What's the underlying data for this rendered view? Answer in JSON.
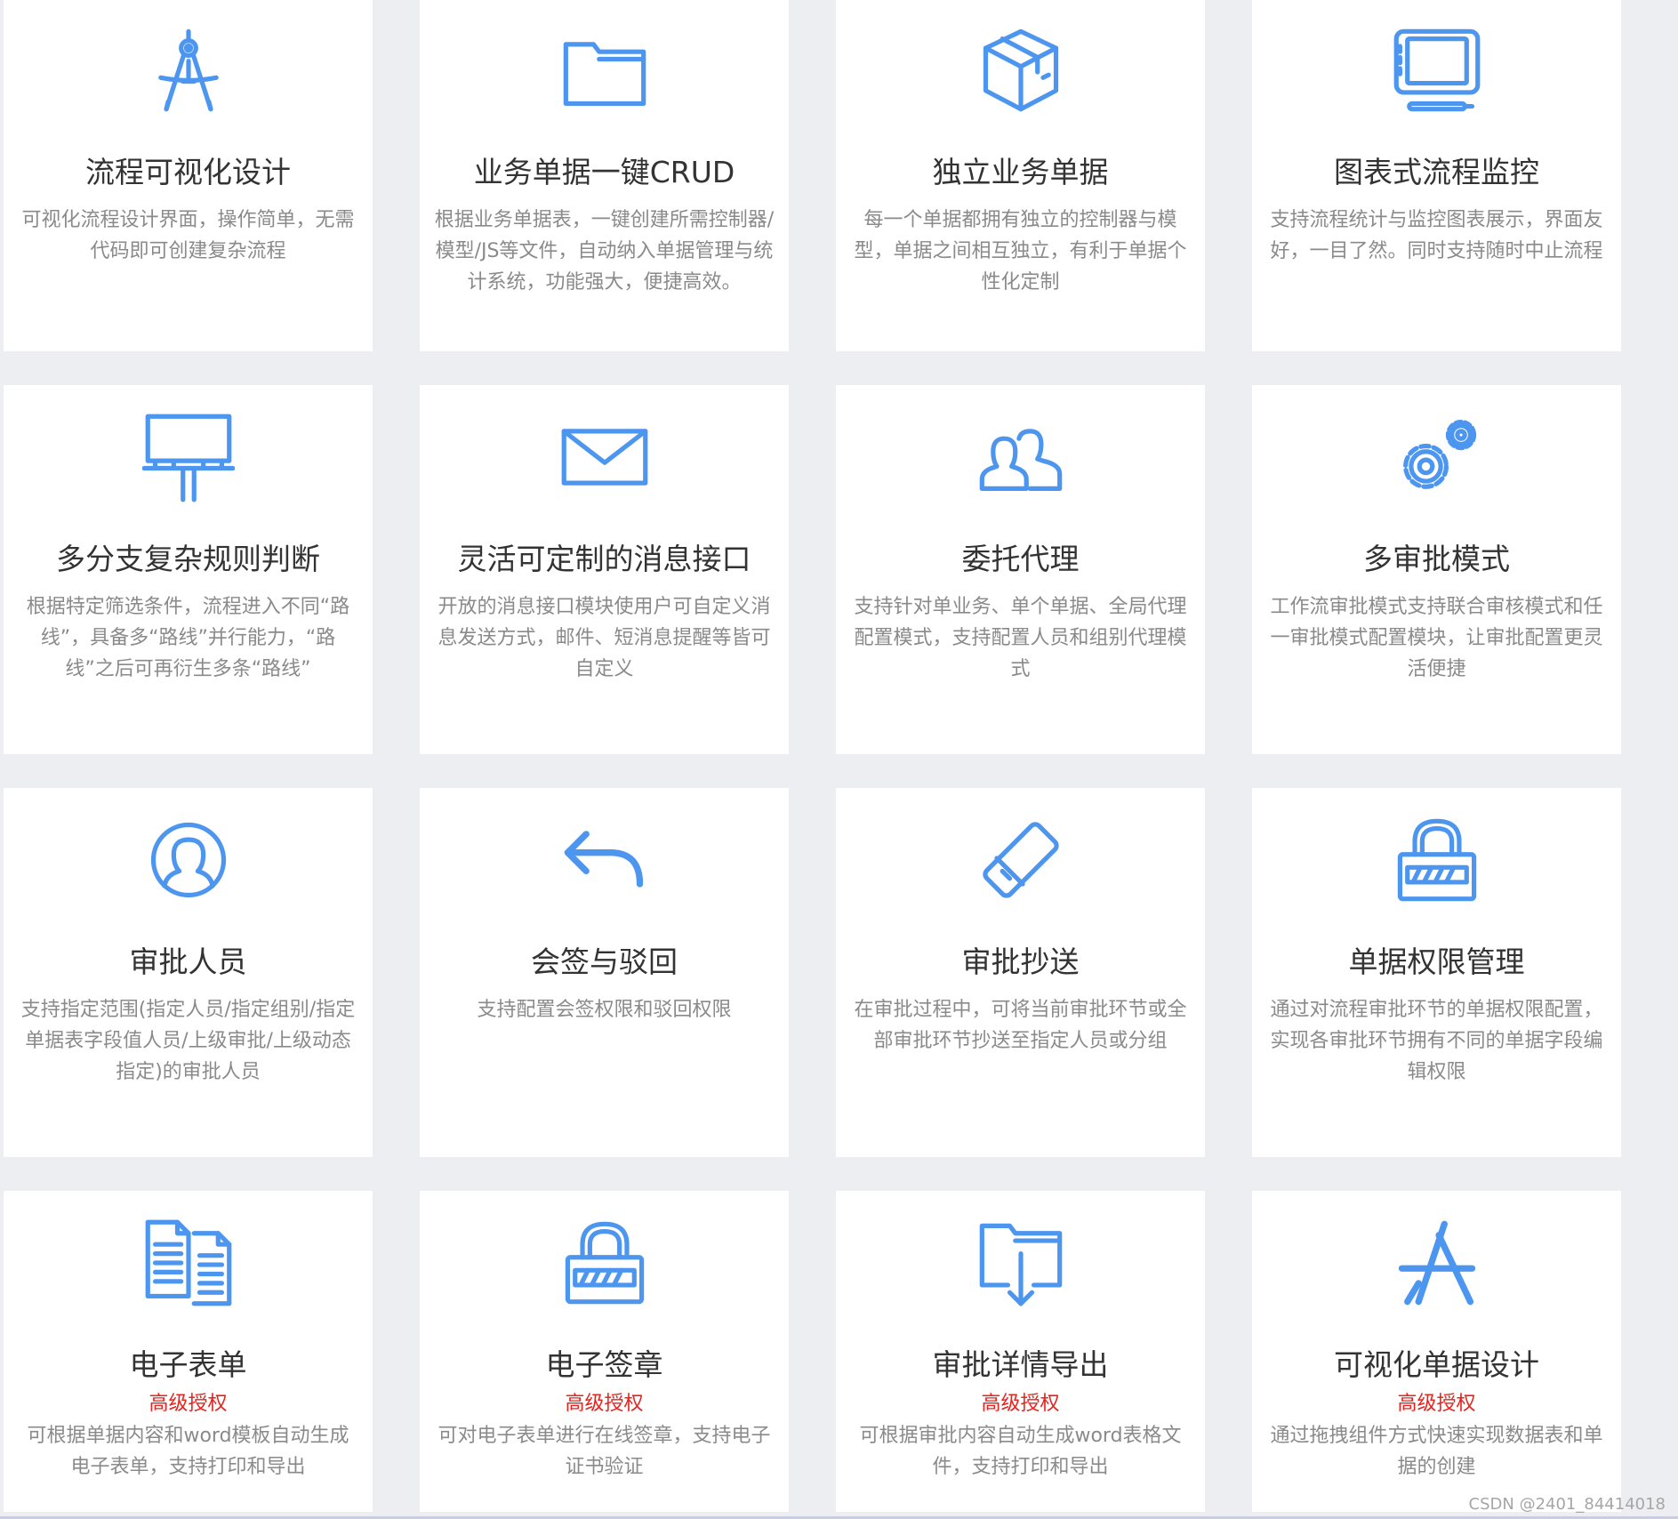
{
  "features": [
    {
      "icon": "compass-icon",
      "title": "流程可视化设计",
      "badge": "",
      "desc": "可视化流程设计界面，操作简单，无需代码即可创建复杂流程"
    },
    {
      "icon": "folder-icon",
      "title": "业务单据一键CRUD",
      "badge": "",
      "desc": "根据业务单据表，一键创建所需控制器/模型/JS等文件，自动纳入单据管理与统计系统，功能强大，便捷高效。"
    },
    {
      "icon": "box-icon",
      "title": "独立业务单据",
      "badge": "",
      "desc": "每一个单据都拥有独立的控制器与模型，单据之间相互独立，有利于单据个性化定制"
    },
    {
      "icon": "tablet-monitor-icon",
      "title": "图表式流程监控",
      "badge": "",
      "desc": "支持流程统计与监控图表展示，界面友好，一目了然。同时支持随时中止流程"
    },
    {
      "icon": "billboard-icon",
      "title": "多分支复杂规则判断",
      "badge": "",
      "desc": "根据特定筛选条件，流程进入不同“路线”，具备多“路线”并行能力，“路线”之后可再衍生多条“路线”"
    },
    {
      "icon": "envelope-icon",
      "title": "灵活可定制的消息接口",
      "badge": "",
      "desc": "开放的消息接口模块使用户可自定义消息发送方式，邮件、短消息提醒等皆可自定义"
    },
    {
      "icon": "users-icon",
      "title": "委托代理",
      "badge": "",
      "desc": "支持针对单业务、单个单据、全局代理配置模式，支持配置人员和组别代理模式"
    },
    {
      "icon": "gears-icon",
      "title": "多审批模式",
      "badge": "",
      "desc": "工作流审批模式支持联合审核模式和任一审批模式配置模块，让审批配置更灵活便捷"
    },
    {
      "icon": "user-circle-icon",
      "title": "审批人员",
      "badge": "",
      "desc": "支持指定范围(指定人员/指定组别/指定单据表字段值人员/上级审批/上级动态指定)的审批人员"
    },
    {
      "icon": "reply-arrow-icon",
      "title": "会签与驳回",
      "badge": "",
      "desc": "支持配置会签权限和驳回权限"
    },
    {
      "icon": "eraser-icon",
      "title": "审批抄送",
      "badge": "",
      "desc": "在审批过程中，可将当前审批环节或全部审批环节抄送至指定人员或分组"
    },
    {
      "icon": "padlock-icon",
      "title": "单据权限管理",
      "badge": "",
      "desc": "通过对流程审批环节的单据权限配置，实现各审批环节拥有不同的单据字段编辑权限"
    },
    {
      "icon": "documents-icon",
      "title": "电子表单",
      "badge": "高级授权",
      "desc": "可根据单据内容和word模板自动生成电子表单，支持打印和导出"
    },
    {
      "icon": "padlock-icon",
      "title": "电子签章",
      "badge": "高级授权",
      "desc": "可对电子表单进行在线签章，支持电子证书验证"
    },
    {
      "icon": "folder-download-icon",
      "title": "审批详情导出",
      "badge": "高级授权",
      "desc": "可根据审批内容自动生成word表格文件，支持打印和导出"
    },
    {
      "icon": "app-design-icon",
      "title": "可视化单据设计",
      "badge": "高级授权",
      "desc": "通过拖拽组件方式快速实现数据表和单据的创建"
    }
  ],
  "watermark": "CSDN @2401_84414018",
  "colors": {
    "icon": "#4d96f0",
    "badge": "#e8221c",
    "title": "#333333",
    "desc": "#8a8a8a",
    "background": "#eceef2"
  }
}
